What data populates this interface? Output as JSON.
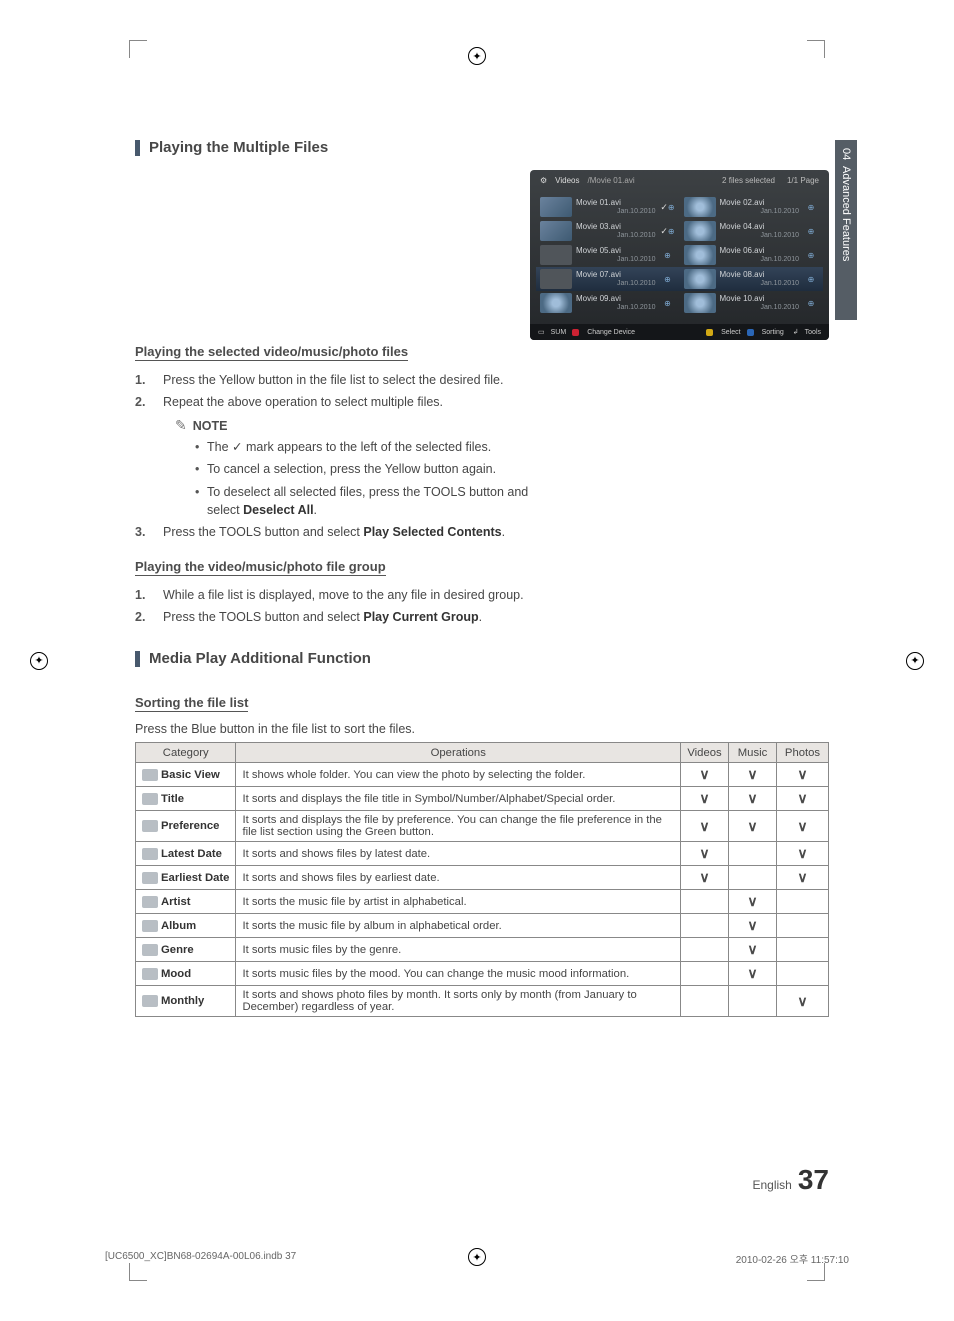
{
  "sidetab": {
    "num": "04",
    "label": "Advanced Features"
  },
  "h_playmulti": "Playing the Multiple Files",
  "sub_selected": "Playing the selected video/music/photo files",
  "steps_sel": [
    {
      "n": "1.",
      "t": "Press the Yellow button in the file list to select the desired file."
    },
    {
      "n": "2.",
      "t": "Repeat the above operation to select multiple files."
    }
  ],
  "note_label": "NOTE",
  "note_bul": [
    "The  ✓  mark appears to the left of the selected files.",
    "To cancel a selection, press the Yellow button again.",
    "To deselect all selected files, press the TOOLS button and select Deselect All."
  ],
  "deselect_b": "Deselect All",
  "step3": {
    "n": "3.",
    "pre": "Press the TOOLS button and select ",
    "b": "Play Selected Contents",
    "post": "."
  },
  "sub_group": "Playing the video/music/photo file group",
  "steps_grp": [
    {
      "n": "1.",
      "t": "While a file list is displayed, move to the any file in desired group."
    },
    {
      "n": "2.",
      "pre": "Press the TOOLS button and select ",
      "b": "Play Current Group",
      "post": "."
    }
  ],
  "h_mediaplay": "Media Play Additional Function",
  "sub_sort": "Sorting the file list",
  "sort_caption": "Press the Blue button in the file list to sort the files.",
  "table": {
    "head": {
      "cat": "Category",
      "op": "Operations",
      "v": "Videos",
      "m": "Music",
      "p": "Photos"
    },
    "rows": [
      {
        "cat": "Basic View",
        "op": "It shows whole folder. You can view the photo by selecting the folder.",
        "v": true,
        "m": true,
        "p": true
      },
      {
        "cat": "Title",
        "op": "It sorts and displays the file title in Symbol/Number/Alphabet/Special order.",
        "v": true,
        "m": true,
        "p": true
      },
      {
        "cat": "Preference",
        "op": "It sorts and displays the file by preference. You can change the file preference in the file list section using the Green button.",
        "v": true,
        "m": true,
        "p": true
      },
      {
        "cat": "Latest Date",
        "op": "It sorts and shows files by latest date.",
        "v": true,
        "m": false,
        "p": true
      },
      {
        "cat": "Earliest Date",
        "op": "It sorts and shows files by earliest date.",
        "v": true,
        "m": false,
        "p": true
      },
      {
        "cat": "Artist",
        "op": "It sorts the music file by artist in alphabetical.",
        "v": false,
        "m": true,
        "p": false
      },
      {
        "cat": "Album",
        "op": "It sorts the music file by album in alphabetical order.",
        "v": false,
        "m": true,
        "p": false
      },
      {
        "cat": "Genre",
        "op": "It sorts music files by the genre.",
        "v": false,
        "m": true,
        "p": false
      },
      {
        "cat": "Mood",
        "op": "It sorts music files by the mood. You can change the music mood information.",
        "v": false,
        "m": true,
        "p": false
      },
      {
        "cat": "Monthly",
        "op": "It sorts and shows photo files by month. It sorts only by month (from January to December) regardless of year.",
        "v": false,
        "m": false,
        "p": true
      }
    ]
  },
  "tv": {
    "crumb1": "Videos",
    "crumb2": "/Movie 01.avi",
    "selcount": "2 files selected",
    "page": "1/1 Page",
    "rows": [
      {
        "t": "Movie 01.avi",
        "d": "Jan.10.2010",
        "mk": "✓",
        "th": "photo"
      },
      {
        "t": "Movie 02.avi",
        "d": "Jan.10.2010",
        "mk": "",
        "th": "lock"
      },
      {
        "t": "Movie 03.avi",
        "d": "Jan.10.2010",
        "mk": "✓",
        "th": "photo"
      },
      {
        "t": "Movie 04.avi",
        "d": "Jan.10.2010",
        "mk": "",
        "th": "lock"
      },
      {
        "t": "Movie 05.avi",
        "d": "Jan.10.2010",
        "mk": "",
        "th": ""
      },
      {
        "t": "Movie 06.avi",
        "d": "Jan.10.2010",
        "mk": "",
        "th": "lock"
      },
      {
        "t": "Movie 07.avi",
        "d": "Jan.10.2010",
        "mk": "",
        "th": "",
        "hi": true
      },
      {
        "t": "Movie 08.avi",
        "d": "Jan.10.2010",
        "mk": "",
        "th": "lock",
        "hi": true
      },
      {
        "t": "Movie 09.avi",
        "d": "Jan.10.2010",
        "mk": "",
        "th": "lock"
      },
      {
        "t": "Movie 10.avi",
        "d": "Jan.10.2010",
        "mk": "",
        "th": "lock"
      }
    ],
    "sum": "SUM",
    "change": "Change Device",
    "select": "Select",
    "sorting": "Sorting",
    "tools": "Tools"
  },
  "footer": {
    "lang": "English",
    "pg": "37"
  },
  "print": {
    "left": "[UC6500_XC]BN68-02694A-00L06.indb   37",
    "right": "2010-02-26   오후 11:57:10"
  }
}
